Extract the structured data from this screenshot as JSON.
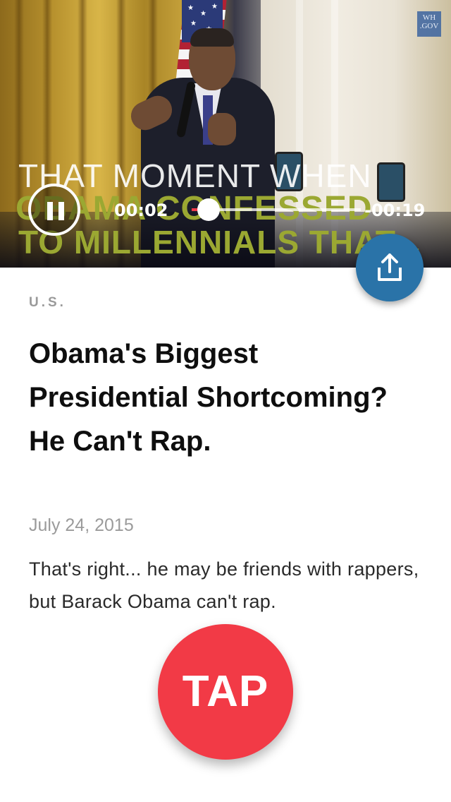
{
  "video": {
    "watermark": "WH .GOV",
    "caption_line1": "THAT MOMENT WHEN",
    "caption_line2": "OBAMA CONFESSED",
    "caption_line3": "TO MILLENNIALS THAT...",
    "time_elapsed": "00:02",
    "time_remaining": "-00:19",
    "progress_fraction": 0.1
  },
  "article": {
    "category": "U.S.",
    "headline": "Obama's Biggest Presidential Shortcoming? He Can't Rap.",
    "date": "July 24, 2015",
    "description": "That's right... he may be friends with rappers, but Barack Obama can't rap."
  },
  "actions": {
    "tap_label": "TAP",
    "share_icon": "share-upload-icon",
    "pause_icon": "pause-icon"
  },
  "colors": {
    "accent_red": "#f23a46",
    "share_blue": "#2a73a8",
    "caption_green": "#9ba832"
  }
}
